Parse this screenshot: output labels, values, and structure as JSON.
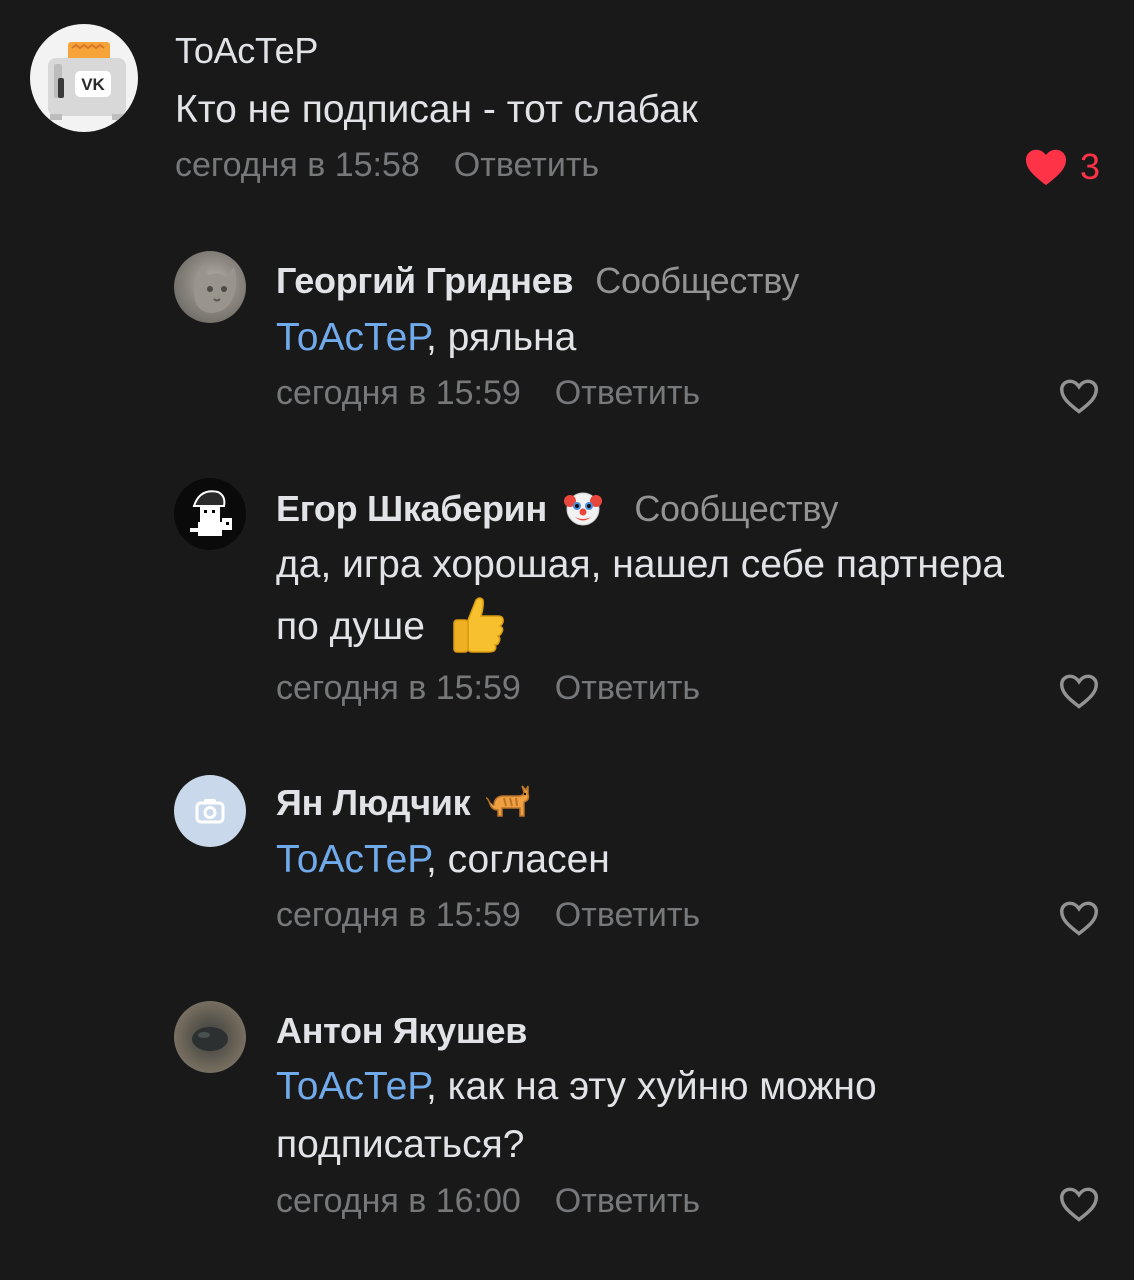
{
  "comments": [
    {
      "author": "ТоАсТеР",
      "recipient": "",
      "mention": "",
      "text": "Кто не подписан - тот слабак",
      "time": "сегодня в 15:58",
      "reply_label": "Ответить",
      "likes": "3",
      "liked": true,
      "like_color": "#ff3347"
    },
    {
      "author": "Георгий Гриднев",
      "recipient": "Сообществу",
      "mention": "ТоАсТеР",
      "text": ", ряльна",
      "time": "сегодня в 15:59",
      "reply_label": "Ответить",
      "liked": false
    },
    {
      "author": "Егор Шкаберин",
      "author_badge_icon": "clown-face-emoji",
      "recipient": "Сообществу",
      "mention": "",
      "text_line1": "да, игра хорошая, нашел себе партнера",
      "text_line2": "по душе",
      "text_emoji_icon": "thumbs-up-emoji",
      "time": "сегодня в 15:59",
      "reply_label": "Ответить",
      "liked": false
    },
    {
      "author": "Ян Людчик",
      "author_badge_icon": "cat-emoji",
      "recipient": "",
      "mention": "ТоАсТеР",
      "text": ", согласен",
      "time": "сегодня в 15:59",
      "reply_label": "Ответить",
      "liked": false,
      "avatar_icon": "camera-icon"
    },
    {
      "author": "Антон Якушев",
      "recipient": "",
      "mention": "ТоАсТеР",
      "text_line1": ", как на эту хуйню можно",
      "text_line2": "подписаться?",
      "time": "сегодня в 16:00",
      "reply_label": "Ответить",
      "liked": false
    }
  ],
  "colors": {
    "background": "#19191a",
    "text": "#e1e3e6",
    "secondary": "#76787a",
    "mention": "#71aaeb",
    "like_active": "#ff3347"
  }
}
